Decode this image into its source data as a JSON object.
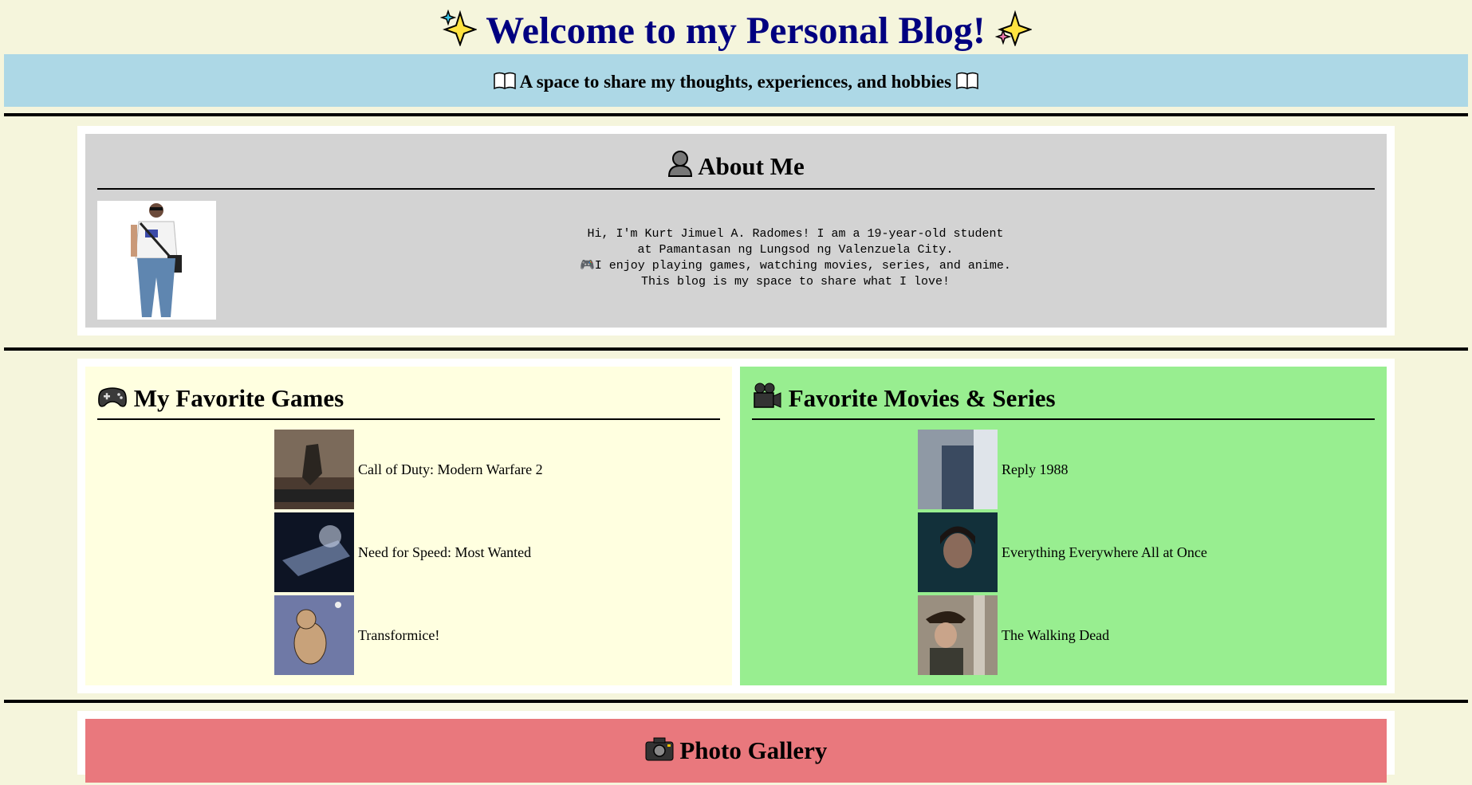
{
  "header": {
    "title": "Welcome to my Personal Blog!",
    "title_icon": "sparkles-icon",
    "subtitle": "A space to share my thoughts, experiences, and hobbies",
    "subtitle_icon": "open-book-icon"
  },
  "about": {
    "title": "About Me",
    "title_icon": "person-silhouette-icon",
    "text": "Hi, I'm Kurt Jimuel A. Radomes! I am a 19-year-old student\nat Pamantasan ng Lungsod ng Valenzuela City.\n🎮I enjoy playing games, watching movies, series, and anime.\nThis blog is my space to share what I love!"
  },
  "games": {
    "title": "My Favorite Games",
    "title_icon": "game-controller-icon",
    "items": [
      {
        "label": "Call of Duty: Modern Warfare 2"
      },
      {
        "label": "Need for Speed: Most Wanted"
      },
      {
        "label": "Transformice!"
      }
    ]
  },
  "movies": {
    "title": "Favorite Movies & Series",
    "title_icon": "movie-camera-icon",
    "items": [
      {
        "label": "Reply 1988"
      },
      {
        "label": "Everything Everywhere All at Once"
      },
      {
        "label": "The Walking Dead"
      }
    ]
  },
  "gallery": {
    "title": "Photo Gallery",
    "title_icon": "camera-icon"
  },
  "colors": {
    "page_bg": "#f5f5dc",
    "title_color": "#000080",
    "subtitle_bg": "#add8e6",
    "about_bg": "#d3d3d3",
    "games_bg": "#ffffe0",
    "movies_bg": "#98ee90",
    "gallery_bg": "#e9787d"
  }
}
